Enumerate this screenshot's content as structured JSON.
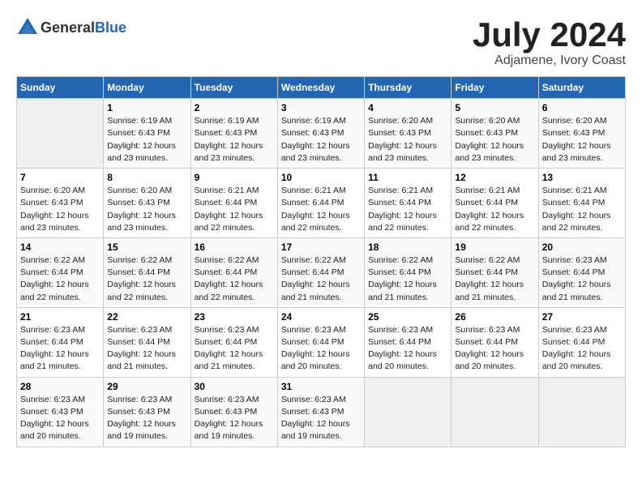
{
  "header": {
    "logo_general": "General",
    "logo_blue": "Blue",
    "month_year": "July 2024",
    "location": "Adjamene, Ivory Coast"
  },
  "calendar": {
    "days_of_week": [
      "Sunday",
      "Monday",
      "Tuesday",
      "Wednesday",
      "Thursday",
      "Friday",
      "Saturday"
    ],
    "weeks": [
      [
        {
          "day": "",
          "info": ""
        },
        {
          "day": "1",
          "info": "Sunrise: 6:19 AM\nSunset: 6:43 PM\nDaylight: 12 hours\nand 23 minutes."
        },
        {
          "day": "2",
          "info": "Sunrise: 6:19 AM\nSunset: 6:43 PM\nDaylight: 12 hours\nand 23 minutes."
        },
        {
          "day": "3",
          "info": "Sunrise: 6:19 AM\nSunset: 6:43 PM\nDaylight: 12 hours\nand 23 minutes."
        },
        {
          "day": "4",
          "info": "Sunrise: 6:20 AM\nSunset: 6:43 PM\nDaylight: 12 hours\nand 23 minutes."
        },
        {
          "day": "5",
          "info": "Sunrise: 6:20 AM\nSunset: 6:43 PM\nDaylight: 12 hours\nand 23 minutes."
        },
        {
          "day": "6",
          "info": "Sunrise: 6:20 AM\nSunset: 6:43 PM\nDaylight: 12 hours\nand 23 minutes."
        }
      ],
      [
        {
          "day": "7",
          "info": "Sunrise: 6:20 AM\nSunset: 6:43 PM\nDaylight: 12 hours\nand 23 minutes."
        },
        {
          "day": "8",
          "info": "Sunrise: 6:20 AM\nSunset: 6:43 PM\nDaylight: 12 hours\nand 23 minutes."
        },
        {
          "day": "9",
          "info": "Sunrise: 6:21 AM\nSunset: 6:44 PM\nDaylight: 12 hours\nand 22 minutes."
        },
        {
          "day": "10",
          "info": "Sunrise: 6:21 AM\nSunset: 6:44 PM\nDaylight: 12 hours\nand 22 minutes."
        },
        {
          "day": "11",
          "info": "Sunrise: 6:21 AM\nSunset: 6:44 PM\nDaylight: 12 hours\nand 22 minutes."
        },
        {
          "day": "12",
          "info": "Sunrise: 6:21 AM\nSunset: 6:44 PM\nDaylight: 12 hours\nand 22 minutes."
        },
        {
          "day": "13",
          "info": "Sunrise: 6:21 AM\nSunset: 6:44 PM\nDaylight: 12 hours\nand 22 minutes."
        }
      ],
      [
        {
          "day": "14",
          "info": "Sunrise: 6:22 AM\nSunset: 6:44 PM\nDaylight: 12 hours\nand 22 minutes."
        },
        {
          "day": "15",
          "info": "Sunrise: 6:22 AM\nSunset: 6:44 PM\nDaylight: 12 hours\nand 22 minutes."
        },
        {
          "day": "16",
          "info": "Sunrise: 6:22 AM\nSunset: 6:44 PM\nDaylight: 12 hours\nand 22 minutes."
        },
        {
          "day": "17",
          "info": "Sunrise: 6:22 AM\nSunset: 6:44 PM\nDaylight: 12 hours\nand 21 minutes."
        },
        {
          "day": "18",
          "info": "Sunrise: 6:22 AM\nSunset: 6:44 PM\nDaylight: 12 hours\nand 21 minutes."
        },
        {
          "day": "19",
          "info": "Sunrise: 6:22 AM\nSunset: 6:44 PM\nDaylight: 12 hours\nand 21 minutes."
        },
        {
          "day": "20",
          "info": "Sunrise: 6:23 AM\nSunset: 6:44 PM\nDaylight: 12 hours\nand 21 minutes."
        }
      ],
      [
        {
          "day": "21",
          "info": "Sunrise: 6:23 AM\nSunset: 6:44 PM\nDaylight: 12 hours\nand 21 minutes."
        },
        {
          "day": "22",
          "info": "Sunrise: 6:23 AM\nSunset: 6:44 PM\nDaylight: 12 hours\nand 21 minutes."
        },
        {
          "day": "23",
          "info": "Sunrise: 6:23 AM\nSunset: 6:44 PM\nDaylight: 12 hours\nand 21 minutes."
        },
        {
          "day": "24",
          "info": "Sunrise: 6:23 AM\nSunset: 6:44 PM\nDaylight: 12 hours\nand 20 minutes."
        },
        {
          "day": "25",
          "info": "Sunrise: 6:23 AM\nSunset: 6:44 PM\nDaylight: 12 hours\nand 20 minutes."
        },
        {
          "day": "26",
          "info": "Sunrise: 6:23 AM\nSunset: 6:44 PM\nDaylight: 12 hours\nand 20 minutes."
        },
        {
          "day": "27",
          "info": "Sunrise: 6:23 AM\nSunset: 6:44 PM\nDaylight: 12 hours\nand 20 minutes."
        }
      ],
      [
        {
          "day": "28",
          "info": "Sunrise: 6:23 AM\nSunset: 6:43 PM\nDaylight: 12 hours\nand 20 minutes."
        },
        {
          "day": "29",
          "info": "Sunrise: 6:23 AM\nSunset: 6:43 PM\nDaylight: 12 hours\nand 19 minutes."
        },
        {
          "day": "30",
          "info": "Sunrise: 6:23 AM\nSunset: 6:43 PM\nDaylight: 12 hours\nand 19 minutes."
        },
        {
          "day": "31",
          "info": "Sunrise: 6:23 AM\nSunset: 6:43 PM\nDaylight: 12 hours\nand 19 minutes."
        },
        {
          "day": "",
          "info": ""
        },
        {
          "day": "",
          "info": ""
        },
        {
          "day": "",
          "info": ""
        }
      ]
    ]
  }
}
